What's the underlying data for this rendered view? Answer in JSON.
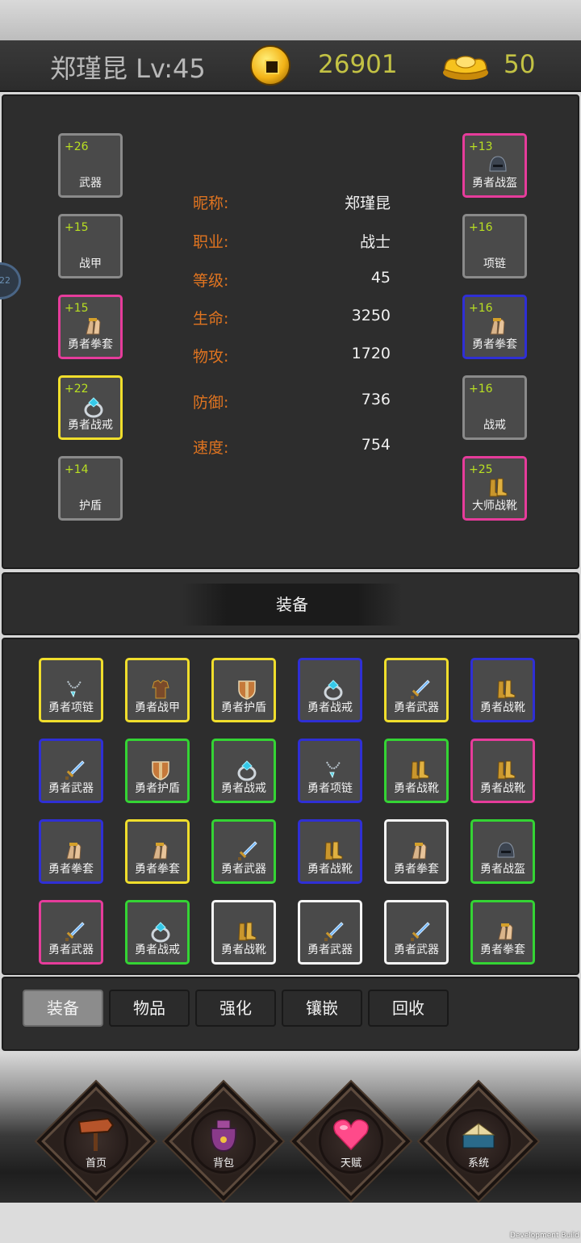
{
  "header": {
    "player_name": "郑瑾昆 Lv:45",
    "coins": "26901",
    "ingots": "50"
  },
  "side_tab_text": "22",
  "left_slots": [
    {
      "level": "+26",
      "name": "武器",
      "border": "grey",
      "icon": ""
    },
    {
      "level": "+15",
      "name": "战甲",
      "border": "grey",
      "icon": ""
    },
    {
      "level": "+15",
      "name": "勇者拳套",
      "border": "pink",
      "icon": "gauntlet-icon"
    },
    {
      "level": "+22",
      "name": "勇者战戒",
      "border": "yellow",
      "icon": "ring-icon"
    },
    {
      "level": "+14",
      "name": "护盾",
      "border": "grey",
      "icon": ""
    }
  ],
  "right_slots": [
    {
      "level": "+13",
      "name": "勇者战盔",
      "border": "pink",
      "icon": "helmet-icon"
    },
    {
      "level": "+16",
      "name": "项链",
      "border": "grey",
      "icon": ""
    },
    {
      "level": "+16",
      "name": "勇者拳套",
      "border": "blue",
      "icon": "gauntlet-icon"
    },
    {
      "level": "+16",
      "name": "战戒",
      "border": "grey",
      "icon": ""
    },
    {
      "level": "+25",
      "name": "大师战靴",
      "border": "pink",
      "icon": "boots-icon"
    }
  ],
  "stats": [
    {
      "label": "昵称:",
      "value": "郑瑾昆"
    },
    {
      "label": "职业:",
      "value": "战士"
    },
    {
      "label": "等级:",
      "value": "45"
    },
    {
      "label": "生命:",
      "value": "3250"
    },
    {
      "label": "物攻:",
      "value": "1720"
    },
    {
      "label": "防御:",
      "value": "736"
    },
    {
      "label": "速度:",
      "value": "754"
    }
  ],
  "equip_title": "装备",
  "inventory": [
    {
      "name": "勇者项链",
      "border": "yellow",
      "icon": "necklace-icon"
    },
    {
      "name": "勇者战甲",
      "border": "yellow",
      "icon": "armor-icon"
    },
    {
      "name": "勇者护盾",
      "border": "yellow",
      "icon": "shield-icon"
    },
    {
      "name": "勇者战戒",
      "border": "blue",
      "icon": "ring-icon"
    },
    {
      "name": "勇者武器",
      "border": "yellow",
      "icon": "sword-icon"
    },
    {
      "name": "勇者战靴",
      "border": "blue",
      "icon": "boots-icon"
    },
    {
      "name": "勇者武器",
      "border": "blue",
      "icon": "sword-icon"
    },
    {
      "name": "勇者护盾",
      "border": "green",
      "icon": "shield-icon"
    },
    {
      "name": "勇者战戒",
      "border": "green",
      "icon": "ring-icon"
    },
    {
      "name": "勇者项链",
      "border": "blue",
      "icon": "necklace-icon"
    },
    {
      "name": "勇者战靴",
      "border": "green",
      "icon": "boots-icon"
    },
    {
      "name": "勇者战靴",
      "border": "pink",
      "icon": "boots-icon"
    },
    {
      "name": "勇者拳套",
      "border": "blue",
      "icon": "gauntlet-icon"
    },
    {
      "name": "勇者拳套",
      "border": "yellow",
      "icon": "gauntlet-icon"
    },
    {
      "name": "勇者武器",
      "border": "green",
      "icon": "sword-icon"
    },
    {
      "name": "勇者战靴",
      "border": "blue",
      "icon": "boots-icon"
    },
    {
      "name": "勇者拳套",
      "border": "white",
      "icon": "gauntlet-icon"
    },
    {
      "name": "勇者战盔",
      "border": "green",
      "icon": "helmet-icon"
    },
    {
      "name": "勇者武器",
      "border": "pink",
      "icon": "sword-icon"
    },
    {
      "name": "勇者战戒",
      "border": "green",
      "icon": "ring-icon"
    },
    {
      "name": "勇者战靴",
      "border": "white",
      "icon": "boots-icon"
    },
    {
      "name": "勇者武器",
      "border": "white",
      "icon": "sword-icon"
    },
    {
      "name": "勇者武器",
      "border": "white",
      "icon": "sword-icon"
    },
    {
      "name": "勇者拳套",
      "border": "green",
      "icon": "gauntlet-icon"
    }
  ],
  "tabs": [
    {
      "label": "装备",
      "active": true
    },
    {
      "label": "物品",
      "active": false
    },
    {
      "label": "强化",
      "active": false
    },
    {
      "label": "镶嵌",
      "active": false
    },
    {
      "label": "回收",
      "active": false
    }
  ],
  "nav": [
    {
      "label": "首页",
      "icon": "signpost-icon"
    },
    {
      "label": "背包",
      "icon": "bag-icon"
    },
    {
      "label": "天赋",
      "icon": "heart-icon"
    },
    {
      "label": "系统",
      "icon": "book-icon"
    }
  ],
  "dev_build": "Development Build",
  "colors": {
    "level_text": "#b9e022",
    "stat_label": "#e07420",
    "currency": "#c3c244"
  }
}
